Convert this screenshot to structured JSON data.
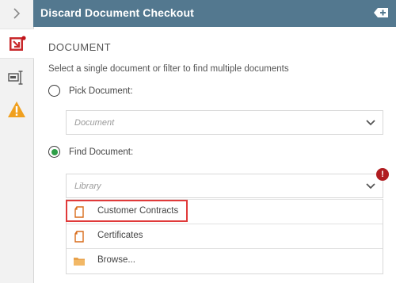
{
  "header": {
    "title": "Discard Document Checkout"
  },
  "rail": {
    "items": [
      "expand-chevron",
      "document-checkout",
      "text-field",
      "warning"
    ],
    "badge_color": "#c0141b"
  },
  "section": {
    "heading": "DOCUMENT",
    "description": "Select a single document or filter to find multiple documents"
  },
  "options": {
    "pick": {
      "label": "Pick Document:",
      "checked": false
    },
    "find": {
      "label": "Find Document:",
      "checked": true
    }
  },
  "pick_select": {
    "placeholder": "Document"
  },
  "find_select": {
    "placeholder": "Library",
    "error_indicator": "!"
  },
  "dropdown": {
    "items": [
      {
        "label": "Customer Contracts",
        "icon": "document-icon",
        "highlighted": true
      },
      {
        "label": "Certificates",
        "icon": "document-icon",
        "highlighted": false
      },
      {
        "label": "Browse...",
        "icon": "folder-icon",
        "highlighted": false
      }
    ]
  },
  "colors": {
    "header_bg": "#53788f",
    "accent_green": "#2e9e47",
    "error_red": "#b01c20",
    "highlight_red": "#e03a3a",
    "icon_orange": "#d86b1a"
  }
}
